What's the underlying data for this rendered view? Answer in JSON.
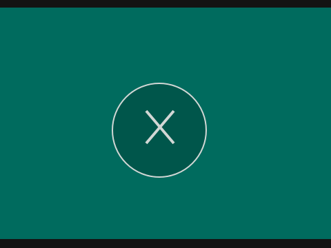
{
  "colors": {
    "letterbox": "#131313",
    "background": "#006b5e",
    "button_fill": "#00564b",
    "button_ring": "#d2d7d5",
    "icon": "#d2d7d5"
  },
  "close_button": {
    "icon": "close-icon"
  }
}
